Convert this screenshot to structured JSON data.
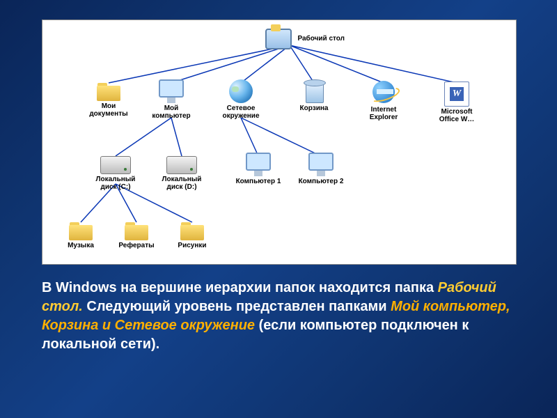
{
  "caption": {
    "t1": "В Windows на вершине иерархии папок находится папка ",
    "h1": "Рабочий стол.",
    "t2": " Следующий уровень представлен папками ",
    "h2": "Мой компьютер, Корзина и Сетевое окружение",
    "t3": " (если компьютер подключен к локальной сети)."
  },
  "nodes": {
    "desktop": {
      "label": "Рабочий стол"
    },
    "mydocs": {
      "label": "Мои документы"
    },
    "mycomp": {
      "label": "Мой компьютер"
    },
    "network": {
      "label": "Сетевое окружение"
    },
    "bin": {
      "label": "Корзина"
    },
    "ie": {
      "label": "Internet Explorer"
    },
    "word": {
      "label": "Microsoft Office W…"
    },
    "diskc": {
      "label": "Локальный диск (C:)"
    },
    "diskd": {
      "label": "Локальный диск (D:)"
    },
    "pc1": {
      "label": "Компьютер 1"
    },
    "pc2": {
      "label": "Компьютер 2"
    },
    "music": {
      "label": "Музыка"
    },
    "refs": {
      "label": "Рефераты"
    },
    "pics": {
      "label": "Рисунки"
    }
  }
}
